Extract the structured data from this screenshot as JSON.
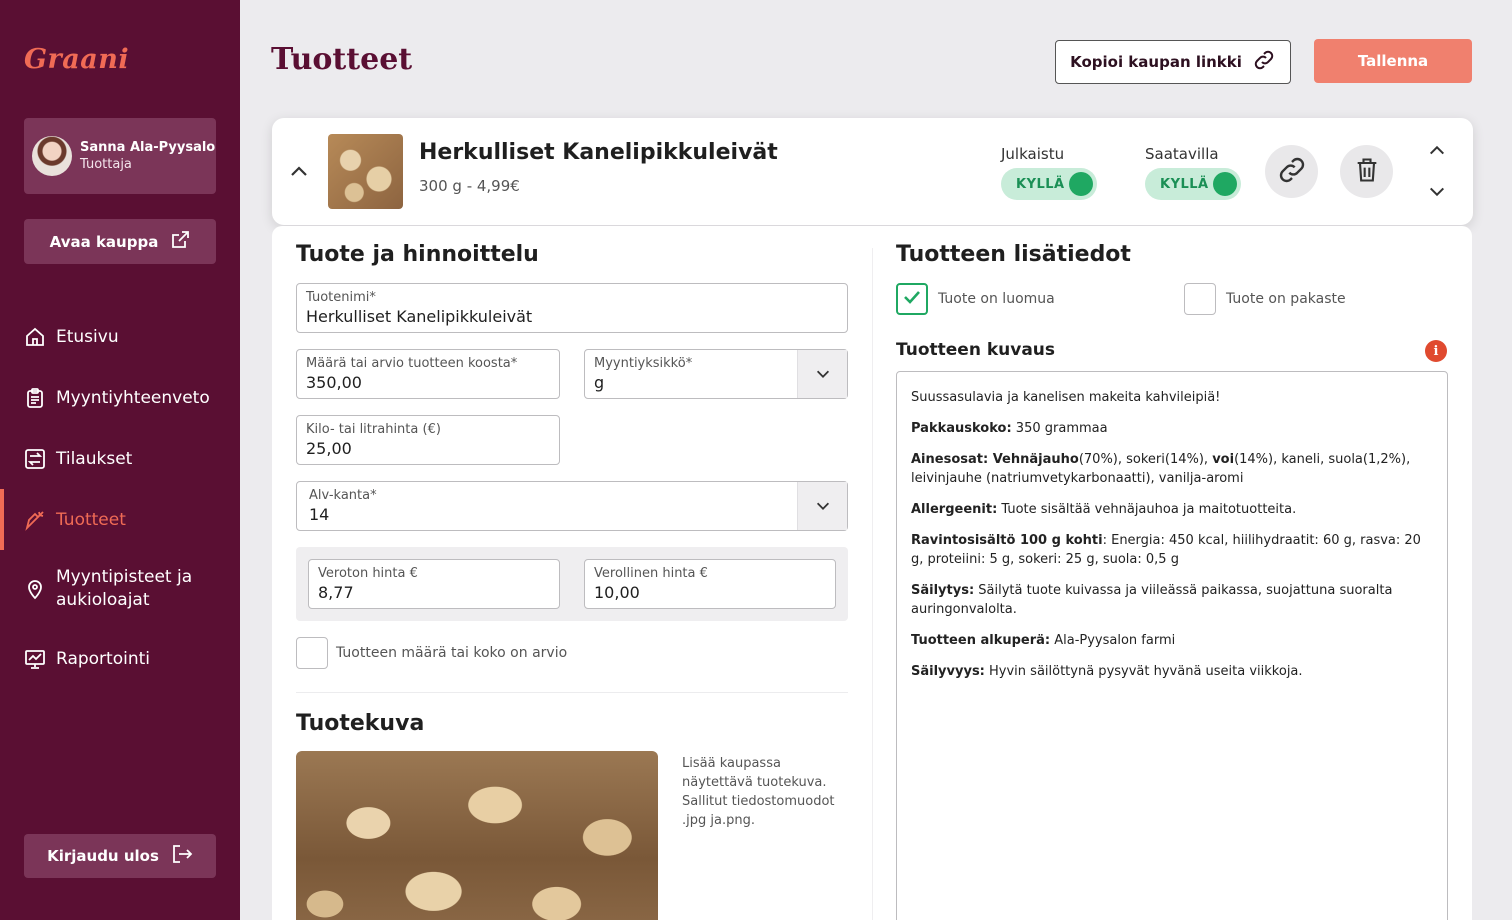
{
  "app": {
    "logo": "Graani"
  },
  "user": {
    "name": "Sanna Ala-Pyysalo",
    "role": "Tuottaja"
  },
  "sidebar": {
    "open_shop_label": "Avaa kauppa",
    "items": [
      {
        "label": "Etusivu",
        "icon": "home-icon"
      },
      {
        "label": "Myyntiyhteenveto",
        "icon": "clipboard-icon"
      },
      {
        "label": "Tilaukset",
        "icon": "exchange-icon"
      },
      {
        "label": "Tuotteet",
        "icon": "carrot-icon",
        "active": true
      },
      {
        "label": "Myyntipisteet ja aukioloajat",
        "icon": "location-pin-icon"
      },
      {
        "label": "Raportointi",
        "icon": "chart-screen-icon"
      }
    ],
    "logout_label": "Kirjaudu ulos"
  },
  "header": {
    "title": "Tuotteet",
    "copy_link_label": "Kopioi kaupan linkki",
    "save_label": "Tallenna"
  },
  "product": {
    "name": "Herkulliset Kanelipikkuleivät",
    "size_price": "300 g  - 4,99€",
    "published_label": "Julkaistu",
    "published_value": "KYLLÄ",
    "available_label": "Saatavilla",
    "available_value": "KYLLÄ",
    "accent_green": "#1fa862"
  },
  "pricing": {
    "section_title": "Tuote ja hinnoittelu",
    "name_label": "Tuotenimi*",
    "name_value": "Herkulliset Kanelipikkuleivät",
    "amount_label": "Määrä tai arvio tuotteen koosta*",
    "amount_value": "350,00",
    "unit_label": "Myyntiyksikkö*",
    "unit_value": "g",
    "kilo_label": "Kilo- tai litrahinta (€)",
    "kilo_value": "25,00",
    "vat_label": "Alv-kanta*",
    "vat_value": "14",
    "net_label": "Veroton hinta €",
    "net_value": "8,77",
    "gross_label": "Verollinen hinta €",
    "gross_value": "10,00",
    "estimate_label": "Tuotteen määrä tai koko on arvio",
    "estimate_checked": false
  },
  "image": {
    "section_title": "Tuotekuva",
    "hint": "Lisää kaupassa näytettävä tuotekuva. Sallitut tiedostomuodot .jpg ja.png."
  },
  "details": {
    "section_title": "Tuotteen lisätiedot",
    "organic_label": "Tuote on luomua",
    "organic_checked": true,
    "frozen_label": "Tuote on pakaste",
    "frozen_checked": false,
    "description_title": "Tuotteen kuvaus",
    "description": [
      {
        "bold": "",
        "text": "Suussasulavia ja kanelisen makeita kahvileipiä!"
      },
      {
        "bold": "Pakkauskoko:",
        "text": " 350 grammaa"
      },
      {
        "bold": "Ainesosat: Vehnäjauho",
        "text": "(70%), sokeri(14%), ",
        "bold2": "voi",
        "text2": "(14%), kaneli, suola(1,2%), leivinjauhe (natriumvetykarbonaatti), vanilja-aromi"
      },
      {
        "bold": "Allergeenit:",
        "text": " Tuote sisältää vehnäjauhoa ja maitotuotteita."
      },
      {
        "bold": "Ravintosisältö 100 g kohti",
        "text": ": Energia: 450 kcal, hiilihydraatit: 60 g, rasva: 20 g, proteiini: 5 g, sokeri: 25 g, suola: 0,5 g"
      },
      {
        "bold": "Säilytys:",
        "text": " Säilytä tuote kuivassa ja viileässä paikassa, suojattuna suoralta auringonvalolta."
      },
      {
        "bold": "Tuotteen alkuperä:",
        "text": " Ala-Pyysalon farmi"
      },
      {
        "bold": "Säilyvyys:",
        "text": " Hyvin säilöttynä pysyvät hyvänä useita viikkoja."
      }
    ]
  },
  "colors": {
    "sidebar": "#5a0f33",
    "accent": "#f06b55",
    "save": "#f0806e"
  }
}
